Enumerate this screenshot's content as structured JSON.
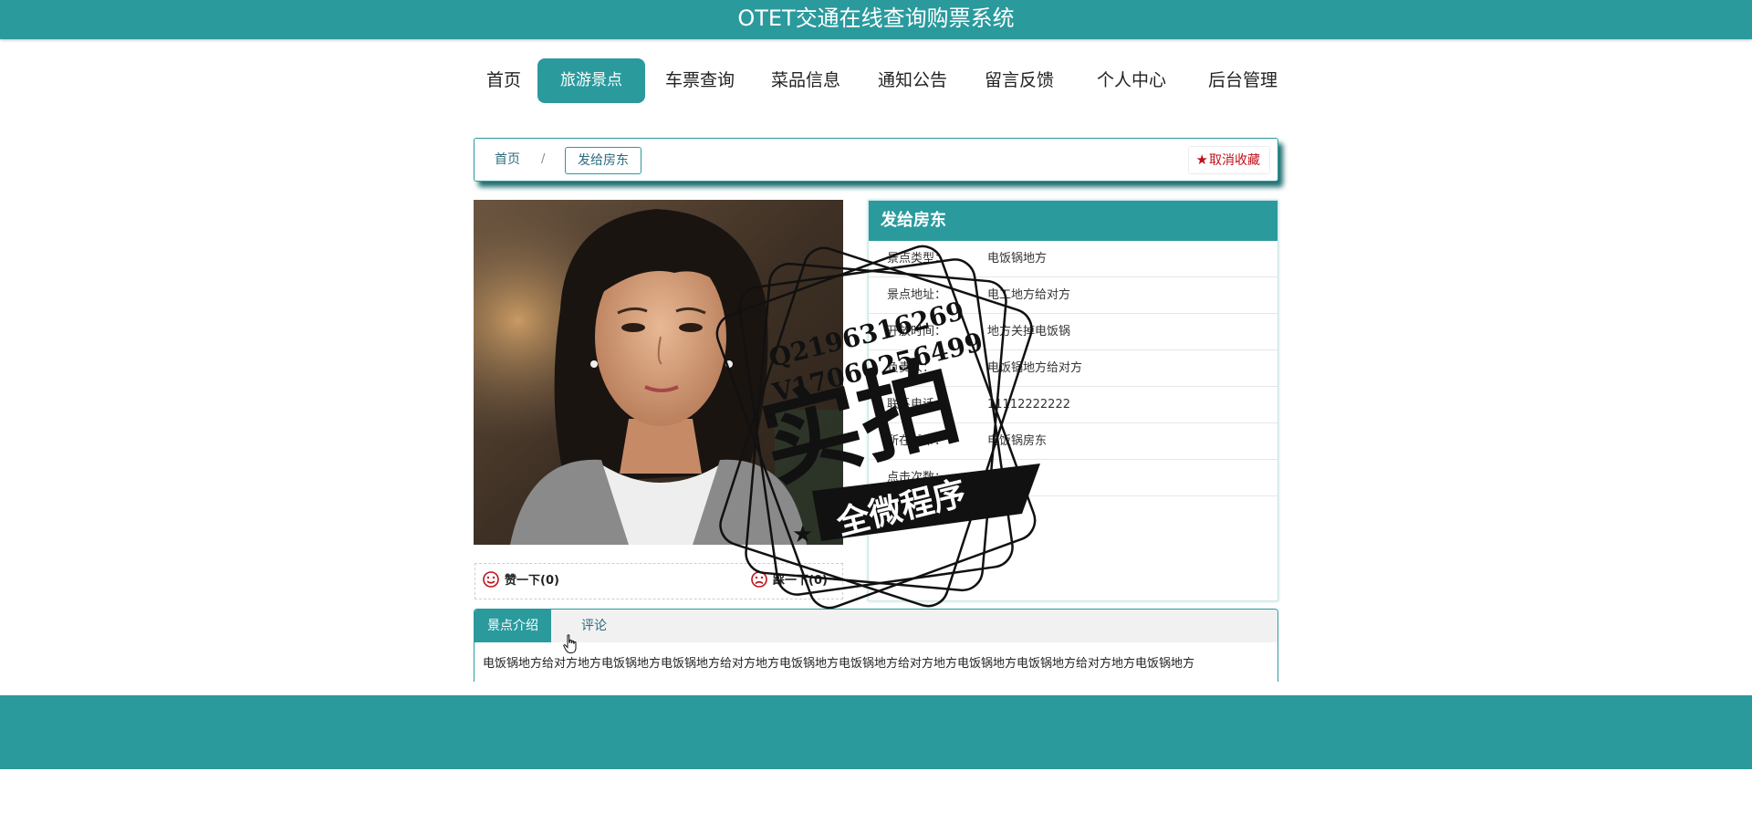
{
  "header": {
    "title": "OTET交通在线查询购票系统"
  },
  "nav": {
    "items": [
      {
        "label": "首页",
        "active": false
      },
      {
        "label": "旅游景点",
        "active": true
      },
      {
        "label": "车票查询",
        "active": false
      },
      {
        "label": "菜品信息",
        "active": false
      },
      {
        "label": "通知公告",
        "active": false
      },
      {
        "label": "留言反馈",
        "active": false
      },
      {
        "label": "个人中心",
        "active": false
      },
      {
        "label": "后台管理",
        "active": false
      }
    ]
  },
  "breadcrumb": {
    "home": "首页",
    "separator": "/",
    "current": "发给房东"
  },
  "actions": {
    "unfavorite_label": "取消收藏",
    "unfavorite_icon": "star-icon"
  },
  "votes": {
    "like_label": "赞一下(0)",
    "dislike_label": "踩一下(0)"
  },
  "details": {
    "title": "发给房东",
    "rows": [
      {
        "label": "景点类型：",
        "value": "电饭锅地方"
      },
      {
        "label": "景点地址：",
        "value": "电工地方给对方"
      },
      {
        "label": "开放时间：",
        "value": "地方关掉电饭锅"
      },
      {
        "label": "负责人：",
        "value": "电饭锅地方给对方"
      },
      {
        "label": "联系电话：",
        "value": "11112222222"
      },
      {
        "label": "所在城市：",
        "value": "电饭锅房东"
      },
      {
        "label": "点击次数：",
        "value": ""
      }
    ]
  },
  "tabs": {
    "items": [
      {
        "label": "景点介绍",
        "active": true
      },
      {
        "label": "评论",
        "active": false
      }
    ],
    "intro_text": "电饭锅地方给对方地方电饭锅地方电饭锅地方给对方地方电饭锅地方电饭锅地方给对方地方电饭锅地方电饭锅地方给对方地方电饭锅地方"
  },
  "stamp": {
    "qq": "Q2196316269",
    "vx": "V17060256499",
    "main": "实拍",
    "banner": "全微程序"
  },
  "colors": {
    "primary": "#2a9a9d",
    "danger": "#c0101a"
  }
}
